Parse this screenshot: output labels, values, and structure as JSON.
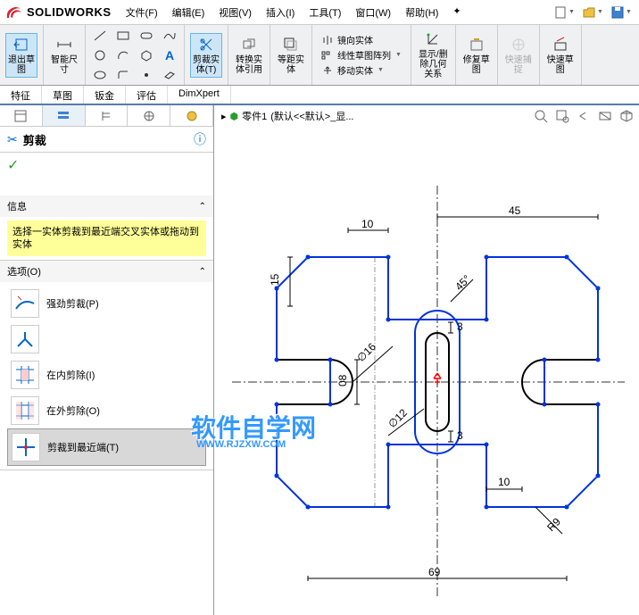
{
  "logo": {
    "brand": "SOLIDWORKS"
  },
  "menus": [
    {
      "label": "文件(F)"
    },
    {
      "label": "编辑(E)"
    },
    {
      "label": "视图(V)"
    },
    {
      "label": "插入(I)"
    },
    {
      "label": "工具(T)"
    },
    {
      "label": "窗口(W)"
    },
    {
      "label": "帮助(H)"
    }
  ],
  "ribbon": {
    "exit_sketch": "退出草\n图",
    "smart_dim": "智能尺\n寸",
    "trim": "剪裁实\n体(T)",
    "convert": "转换实\n体引用",
    "offset": "等距实\n体",
    "mirror": "镜向实体",
    "linear_pattern": "线性草图阵列",
    "move": "移动实体",
    "display_delete": "显示/删\n除几何\n关系",
    "repair": "修复草\n图",
    "quick_snap": "快速捕\n捉",
    "quick_sketch": "快速草\n图"
  },
  "tabs": [
    {
      "label": "特征"
    },
    {
      "label": "草图"
    },
    {
      "label": "钣金"
    },
    {
      "label": "评估"
    },
    {
      "label": "DimXpert"
    }
  ],
  "pm": {
    "title": "剪裁",
    "info_title": "信息",
    "info_text": "选择一实体剪裁到最近端交叉实体或拖动到实体",
    "options_title": "选项(O)",
    "options": [
      {
        "label": "强劲剪裁(P)"
      },
      {
        "label": ""
      },
      {
        "label": "在内剪除(I)"
      },
      {
        "label": "在外剪除(O)"
      },
      {
        "label": "剪裁到最近端(T)"
      }
    ]
  },
  "breadcrumb": {
    "part": "零件1",
    "config": "(默认<<默认>_显..."
  },
  "watermark": {
    "main": "软件自学网",
    "sub": "WWW.RJZXW.COM"
  },
  "dims": {
    "d10": "10",
    "d45": "45",
    "d15": "15",
    "d16": "∅16",
    "d45deg": "45°",
    "d3a": "3",
    "d3b": "3",
    "d12": "∅12",
    "d08": "08",
    "d10b": "10",
    "r9": "R9",
    "d69": "69"
  }
}
